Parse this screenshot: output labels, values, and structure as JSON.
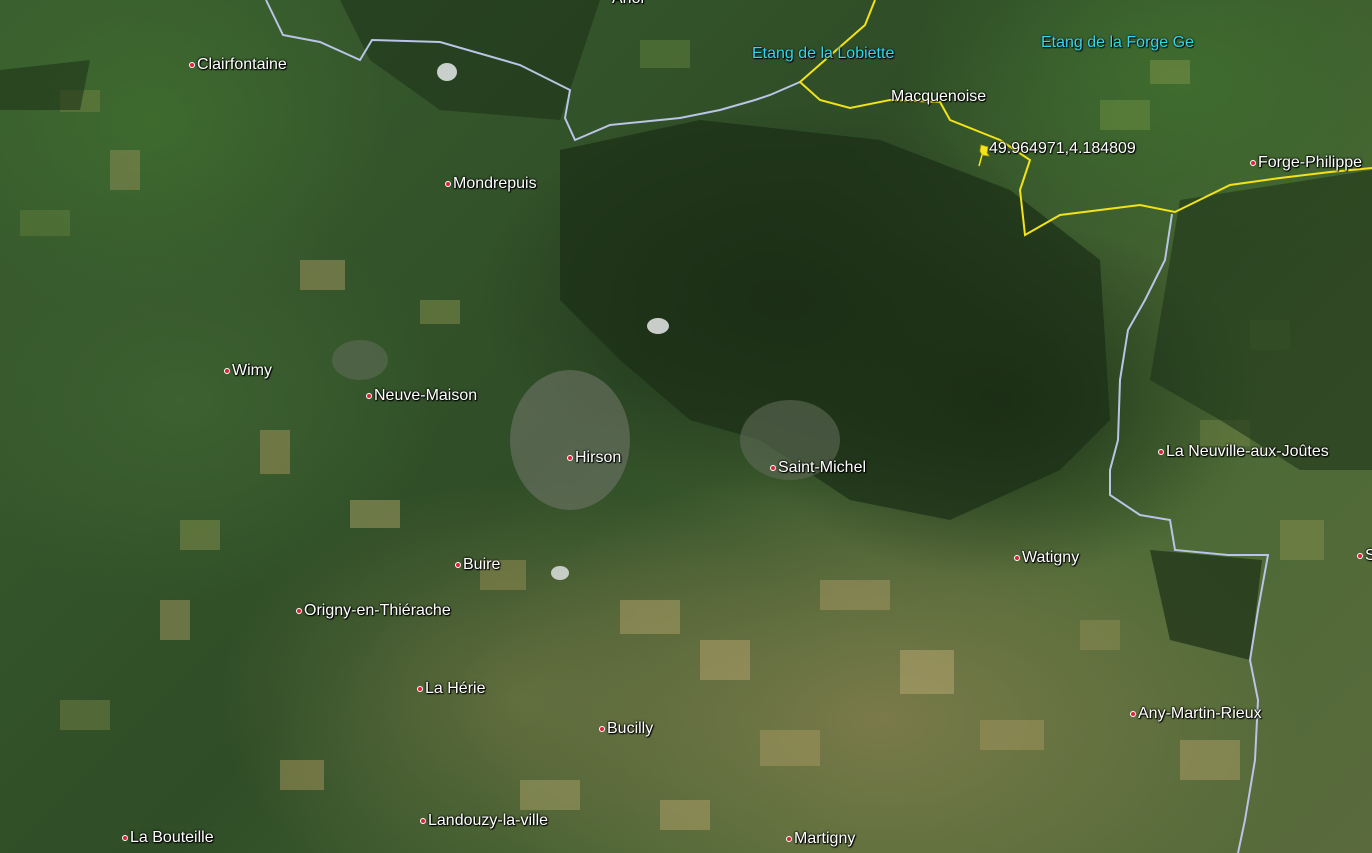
{
  "map": {
    "boundary_colors": {
      "national_border": "#b9c4e6",
      "regional_border": "#f2e21a"
    },
    "water_label_color": "#35d6f0",
    "place_dot_color": "#e0203a",
    "pin_icon": "yellow-pushpin-icon",
    "pin_color": "#f5e51a"
  },
  "places": {
    "clairfontaine": "Clairfontaine",
    "mondrepuis": "Mondrepuis",
    "wimy": "Wimy",
    "neuve_maison": "Neuve-Maison",
    "hirson": "Hirson",
    "saint_michel": "Saint-Michel",
    "buire": "Buire",
    "origny": "Origny-en-Thiérache",
    "la_herie": "La Hérie",
    "bucilly": "Bucilly",
    "landouzy": "Landouzy-la-ville",
    "la_bouteille": "La Bouteille",
    "martigny": "Martigny",
    "watigny": "Watigny",
    "any_martin_rieux": "Any-Martin-Rieux",
    "la_neuville": "La Neuville-aux-Joûtes",
    "forge_philippe": "Forge-Philippe",
    "macquenoise": "Macquenoise",
    "anor": "Anor",
    "s_partial": "S"
  },
  "water": {
    "lobiette": "Etang de la Lobiette",
    "forge_ge": "Etang de la Forge Ge"
  },
  "pin": {
    "coordinates": "49.964971,4.184809"
  }
}
